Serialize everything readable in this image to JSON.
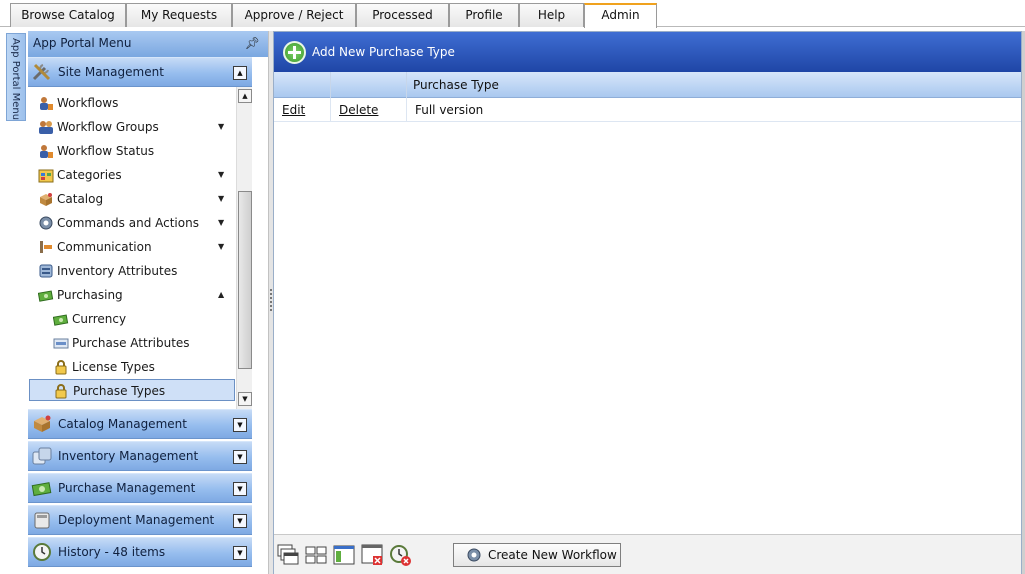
{
  "tabs": [
    {
      "label": "Browse Catalog"
    },
    {
      "label": "My Requests"
    },
    {
      "label": "Approve / Reject"
    },
    {
      "label": "Processed"
    },
    {
      "label": "Profile"
    },
    {
      "label": "Help"
    },
    {
      "label": "Admin",
      "active": true
    }
  ],
  "vertical_tab": {
    "label": "App Portal Menu"
  },
  "left_panel": {
    "title": "App Portal Menu",
    "pin_icon": "pin-icon",
    "site_management": {
      "label": "Site Management",
      "items": [
        {
          "label": "Workflows",
          "icon": "workflow-icon",
          "has_dropdown": false
        },
        {
          "label": "Workflow Groups",
          "icon": "workflow-groups-icon",
          "has_dropdown": true
        },
        {
          "label": "Workflow Status",
          "icon": "workflow-status-icon",
          "has_dropdown": false
        },
        {
          "label": "Categories",
          "icon": "categories-icon",
          "has_dropdown": true
        },
        {
          "label": "Catalog",
          "icon": "catalog-icon",
          "has_dropdown": true
        },
        {
          "label": "Commands and Actions",
          "icon": "gear-icon",
          "has_dropdown": true
        },
        {
          "label": "Communication",
          "icon": "communication-icon",
          "has_dropdown": true
        },
        {
          "label": "Inventory Attributes",
          "icon": "inventory-attributes-icon",
          "has_dropdown": false
        },
        {
          "label": "Purchasing",
          "icon": "money-icon",
          "has_dropdown": true,
          "expanded": true
        },
        {
          "label": "Currency",
          "icon": "money-icon",
          "child": true
        },
        {
          "label": "Purchase Attributes",
          "icon": "purchase-attributes-icon",
          "child": true
        },
        {
          "label": "License Types",
          "icon": "lock-icon",
          "child": true
        },
        {
          "label": "Purchase Types",
          "icon": "lock-icon",
          "child": true,
          "selected": true
        }
      ]
    },
    "sections": [
      {
        "label": "Catalog Management",
        "icon": "catalog-management-icon"
      },
      {
        "label": "Inventory Management",
        "icon": "inventory-management-icon"
      },
      {
        "label": "Purchase Management",
        "icon": "purchase-management-icon"
      },
      {
        "label": "Deployment Management",
        "icon": "deployment-management-icon"
      },
      {
        "label": "History - 48 items",
        "icon": "history-icon"
      }
    ]
  },
  "main": {
    "add_button": "Add New Purchase Type",
    "grid": {
      "columns": [
        "",
        "",
        "Purchase Type"
      ],
      "rows": [
        {
          "edit": "Edit",
          "delete": "Delete",
          "purchase_type": "Full version"
        }
      ]
    },
    "footer": {
      "icons": [
        "cascade-windows-icon",
        "tile-windows-icon",
        "window-icon",
        "close-window-icon",
        "cancel-workflow-icon"
      ],
      "create_workflow_button": "Create New Workflow"
    }
  },
  "colors": {
    "header_blue": "#1f46a6",
    "panel_blue": "#96bdee",
    "active_tab_accent": "#f0a21e"
  }
}
